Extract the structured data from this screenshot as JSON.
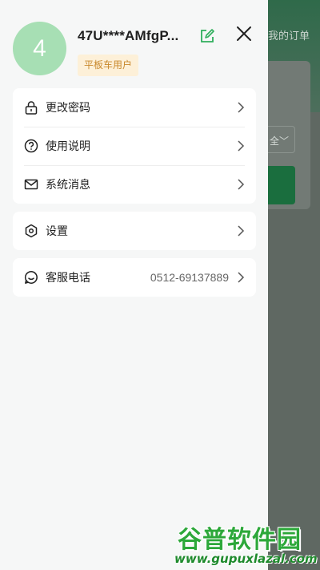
{
  "background": {
    "order_text": "我的订单",
    "select_text": "全"
  },
  "profile": {
    "avatar_text": "4",
    "username": "47U****AMfgP...",
    "role_badge": "平板车用户"
  },
  "menu_group_1": [
    {
      "label": "更改密码",
      "icon": "lock-icon"
    },
    {
      "label": "使用说明",
      "icon": "help-circle-icon"
    },
    {
      "label": "系统消息",
      "icon": "mail-icon"
    }
  ],
  "menu_group_2": [
    {
      "label": "设置",
      "icon": "settings-icon"
    }
  ],
  "menu_group_3": [
    {
      "label": "客服电话",
      "value": "0512-69137889",
      "icon": "customer-service-icon"
    }
  ],
  "watermark": {
    "title": "谷普软件园",
    "url": "www.gupuxlazal.com"
  },
  "colors": {
    "accent": "#2fae5c",
    "avatar_bg": "#a7dfb4",
    "badge_bg": "#fdf0d8",
    "badge_text": "#c9892c"
  }
}
